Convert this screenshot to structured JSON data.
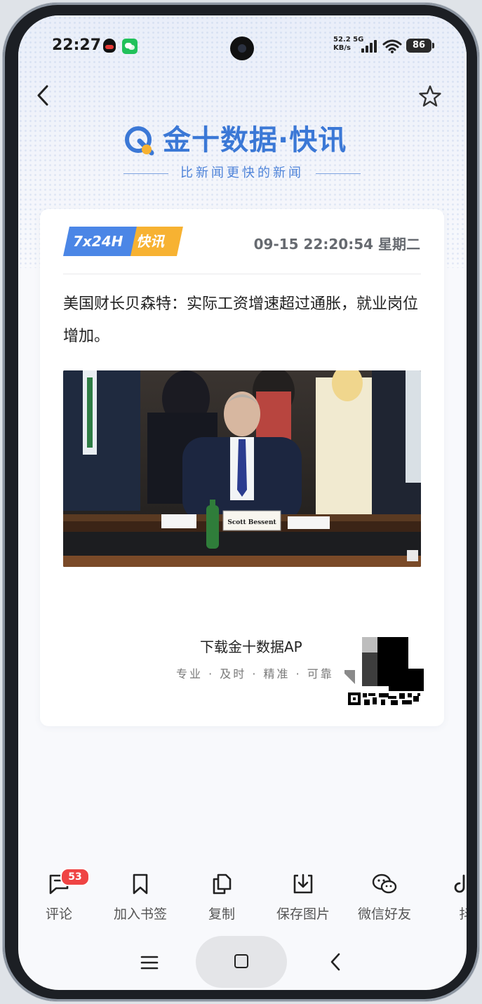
{
  "status_bar": {
    "time": "22:27",
    "network_speed": "52.2",
    "network_speed_unit": "KB/s",
    "network_type": "5G",
    "battery": "86"
  },
  "header": {
    "brand_name": "金十数据·快讯",
    "tagline": "比新闻更快的新闻",
    "icons": [
      "back-arrow-icon",
      "star-outline-icon"
    ]
  },
  "card": {
    "badge_primary": "7x24H",
    "badge_secondary": "快讯",
    "datetime": "09-15 22:20:54 星期二",
    "headline": "美国财长贝森特：实际工资增速超过通胀，就业岗位增加。",
    "photo_nameplate": "Scott Bessent",
    "download_title": "下载金十数据AP",
    "download_subtitle": "专业 · 及时 · 精准 · 可靠"
  },
  "toolbar": {
    "items": [
      {
        "label": "评论",
        "icon": "comment-icon",
        "count": "53"
      },
      {
        "label": "加入书签",
        "icon": "bookmark-icon"
      },
      {
        "label": "复制",
        "icon": "copy-icon"
      },
      {
        "label": "保存图片",
        "icon": "download-icon"
      },
      {
        "label": "微信好友",
        "icon": "wechat-icon"
      },
      {
        "label": "抖",
        "icon": "tiktok-icon"
      }
    ]
  },
  "colors": {
    "brand_blue": "#3b78d6",
    "badge_orange": "#f7b232",
    "badge_blue": "#4b86e6",
    "comment_badge_red": "#ef4444"
  }
}
